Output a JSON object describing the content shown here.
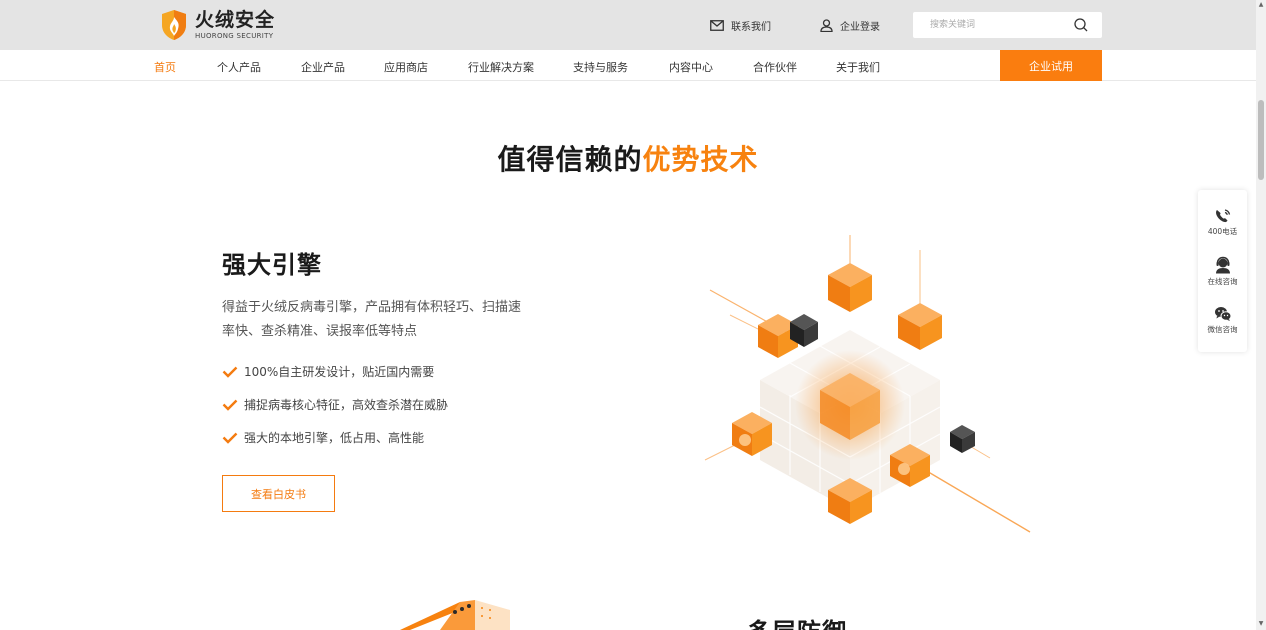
{
  "brand": {
    "name_cn": "火绒安全",
    "name_en": "HUORONG SECURITY",
    "accent_color": "#f7820f"
  },
  "top_links": {
    "contact": "联系我们",
    "login": "企业登录"
  },
  "search": {
    "placeholder": "搜索关键词"
  },
  "nav": {
    "items": [
      "首页",
      "个人产品",
      "企业产品",
      "应用商店",
      "行业解决方案",
      "支持与服务",
      "内容中心",
      "合作伙伴",
      "关于我们"
    ],
    "active_index": 0,
    "trial_button": "企业试用"
  },
  "section": {
    "title_plain": "值得信赖的",
    "title_highlight": "优势技术"
  },
  "feature": {
    "title": "强大引擎",
    "description": "得益于火绒反病毒引擎，产品拥有体积轻巧、扫描速率快、查杀精准、误报率低等特点",
    "bullets": [
      "100%自主研发设计，贴近国内需要",
      "捕捉病毒核心特征，高效查杀潜在威胁",
      "强大的本地引擎，低占用、高性能"
    ],
    "button": "查看白皮书"
  },
  "side_float": {
    "items": [
      {
        "label": "400电话",
        "icon": "phone-icon"
      },
      {
        "label": "在线咨询",
        "icon": "support-agent-icon"
      },
      {
        "label": "微信咨询",
        "icon": "wechat-icon"
      }
    ]
  },
  "next_section": {
    "title": "多层防御"
  }
}
